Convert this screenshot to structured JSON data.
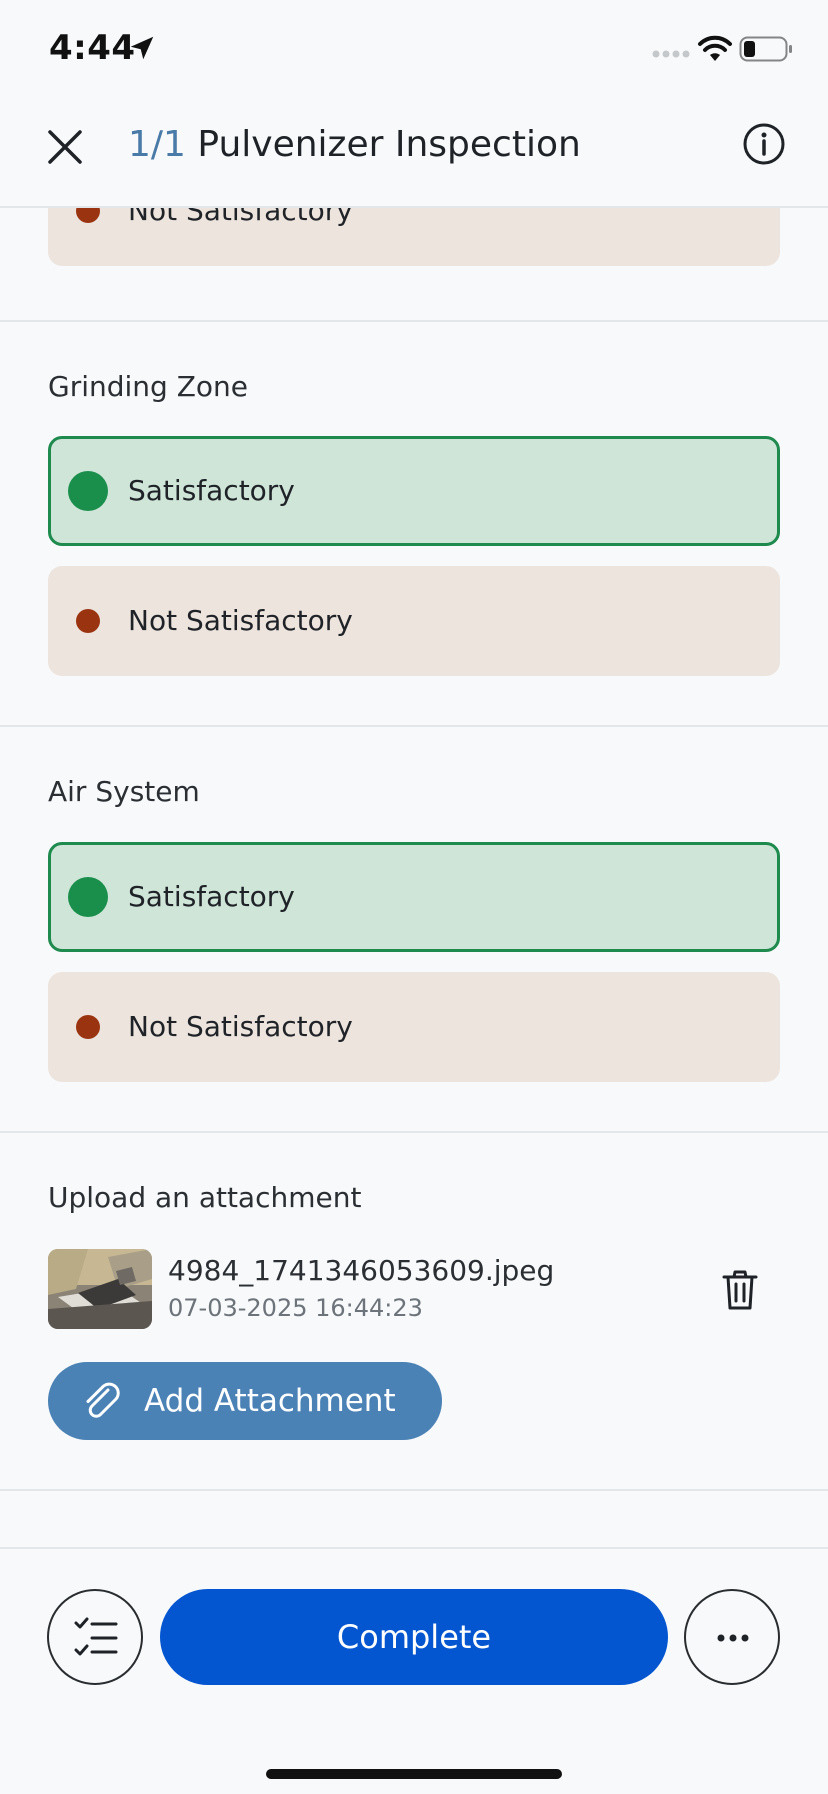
{
  "status_bar": {
    "time": "4:44"
  },
  "header": {
    "count": "1/1",
    "title": "Pulvenizer Inspection"
  },
  "sections": [
    {
      "label": "",
      "options": [
        "Not Satisfactory"
      ]
    },
    {
      "label": "Grinding Zone",
      "options": [
        "Satisfactory",
        "Not Satisfactory"
      ]
    },
    {
      "label": "Air System",
      "options": [
        "Satisfactory",
        "Not Satisfactory"
      ]
    }
  ],
  "attachment": {
    "label": "Upload an attachment",
    "file": {
      "name": "4984_1741346053609.jpeg",
      "date": "07-03-2025 16:44:23"
    },
    "add_label": "Add Attachment"
  },
  "footer": {
    "complete_label": "Complete"
  },
  "colors": {
    "accent": "#0456d0",
    "attachment_button": "#4b82b6",
    "satisfactory": "#1a8f4c",
    "not_satisfactory": "#9a3410",
    "title_count": "#4a7aa7"
  },
  "icons": [
    "location-arrow-icon",
    "wifi-icon",
    "battery-icon",
    "close-icon",
    "info-icon",
    "trash-icon",
    "paperclip-icon",
    "checklist-icon",
    "more-icon"
  ]
}
